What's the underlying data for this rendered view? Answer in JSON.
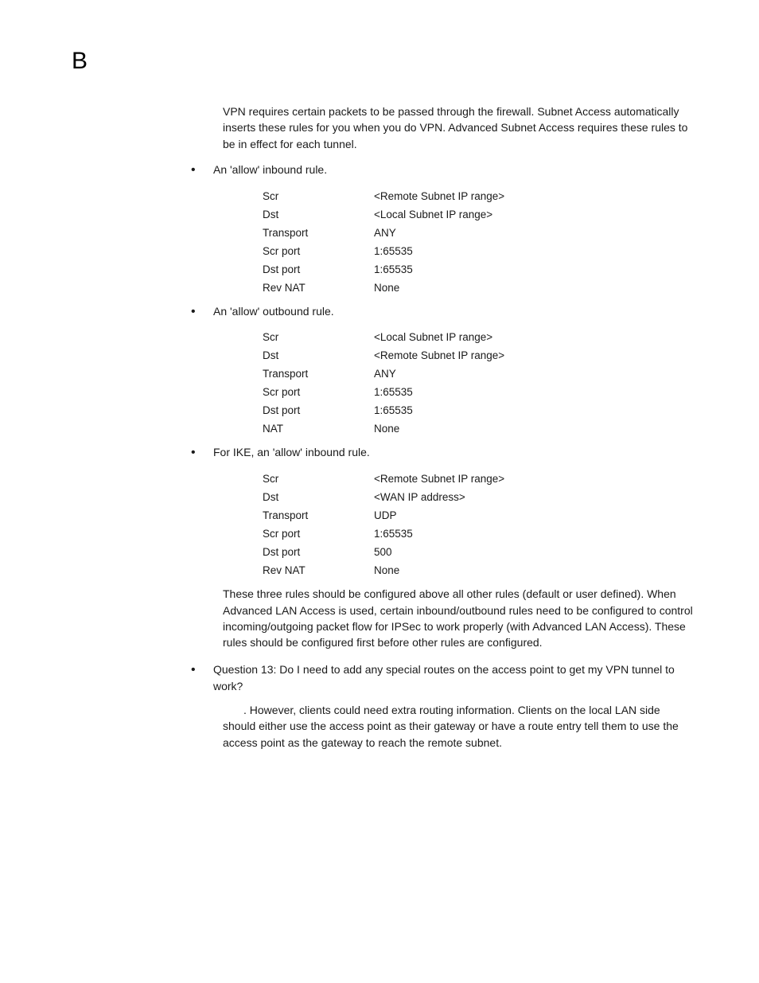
{
  "chapter_letter": "B",
  "intro_para": "VPN requires certain packets to be passed through the firewall. Subnet Access automatically inserts these rules for you when you do VPN. Advanced Subnet Access requires these rules to be in effect for each tunnel.",
  "bullets": [
    {
      "text": "An 'allow' inbound rule.",
      "rows": [
        {
          "key": "Scr",
          "val": "<Remote Subnet IP range>"
        },
        {
          "key": "Dst",
          "val": "<Local Subnet IP range>"
        },
        {
          "key": "Transport",
          "val": "ANY"
        },
        {
          "key": "Scr port",
          "val": "1:65535"
        },
        {
          "key": "Dst port",
          "val": "1:65535"
        },
        {
          "key": "Rev NAT",
          "val": "None"
        }
      ]
    },
    {
      "text": "An 'allow' outbound rule.",
      "rows": [
        {
          "key": "Scr",
          "val": "<Local Subnet IP range>"
        },
        {
          "key": "Dst",
          "val": "<Remote Subnet IP range>"
        },
        {
          "key": "Transport",
          "val": "ANY"
        },
        {
          "key": "Scr port",
          "val": "1:65535"
        },
        {
          "key": "Dst port",
          "val": "1:65535"
        },
        {
          "key": "NAT",
          "val": "None"
        }
      ]
    },
    {
      "text": "For IKE, an 'allow' inbound rule.",
      "rows": [
        {
          "key": "Scr",
          "val": "<Remote Subnet IP range>"
        },
        {
          "key": "Dst",
          "val": "<WAN IP address>"
        },
        {
          "key": "Transport",
          "val": "UDP"
        },
        {
          "key": "Scr port",
          "val": "1:65535"
        },
        {
          "key": "Dst port",
          "val": "500"
        },
        {
          "key": "Rev NAT",
          "val": "None"
        }
      ]
    }
  ],
  "after_tables_para": "These three rules should be configured above all other rules (default or user defined). When Advanced LAN Access is used, certain inbound/outbound rules need to be configured to control incoming/outgoing packet flow for IPSec to work properly (with Advanced LAN Access). These rules should be configured first before other rules are configured.",
  "question13": "Question 13: Do I need to add any special routes on the access point to get my VPN tunnel to work?",
  "answer13": ". However, clients could need extra routing information. Clients on the local LAN side should either use the access point as their gateway or have a route entry tell them to use the access point as the gateway to reach the remote subnet."
}
